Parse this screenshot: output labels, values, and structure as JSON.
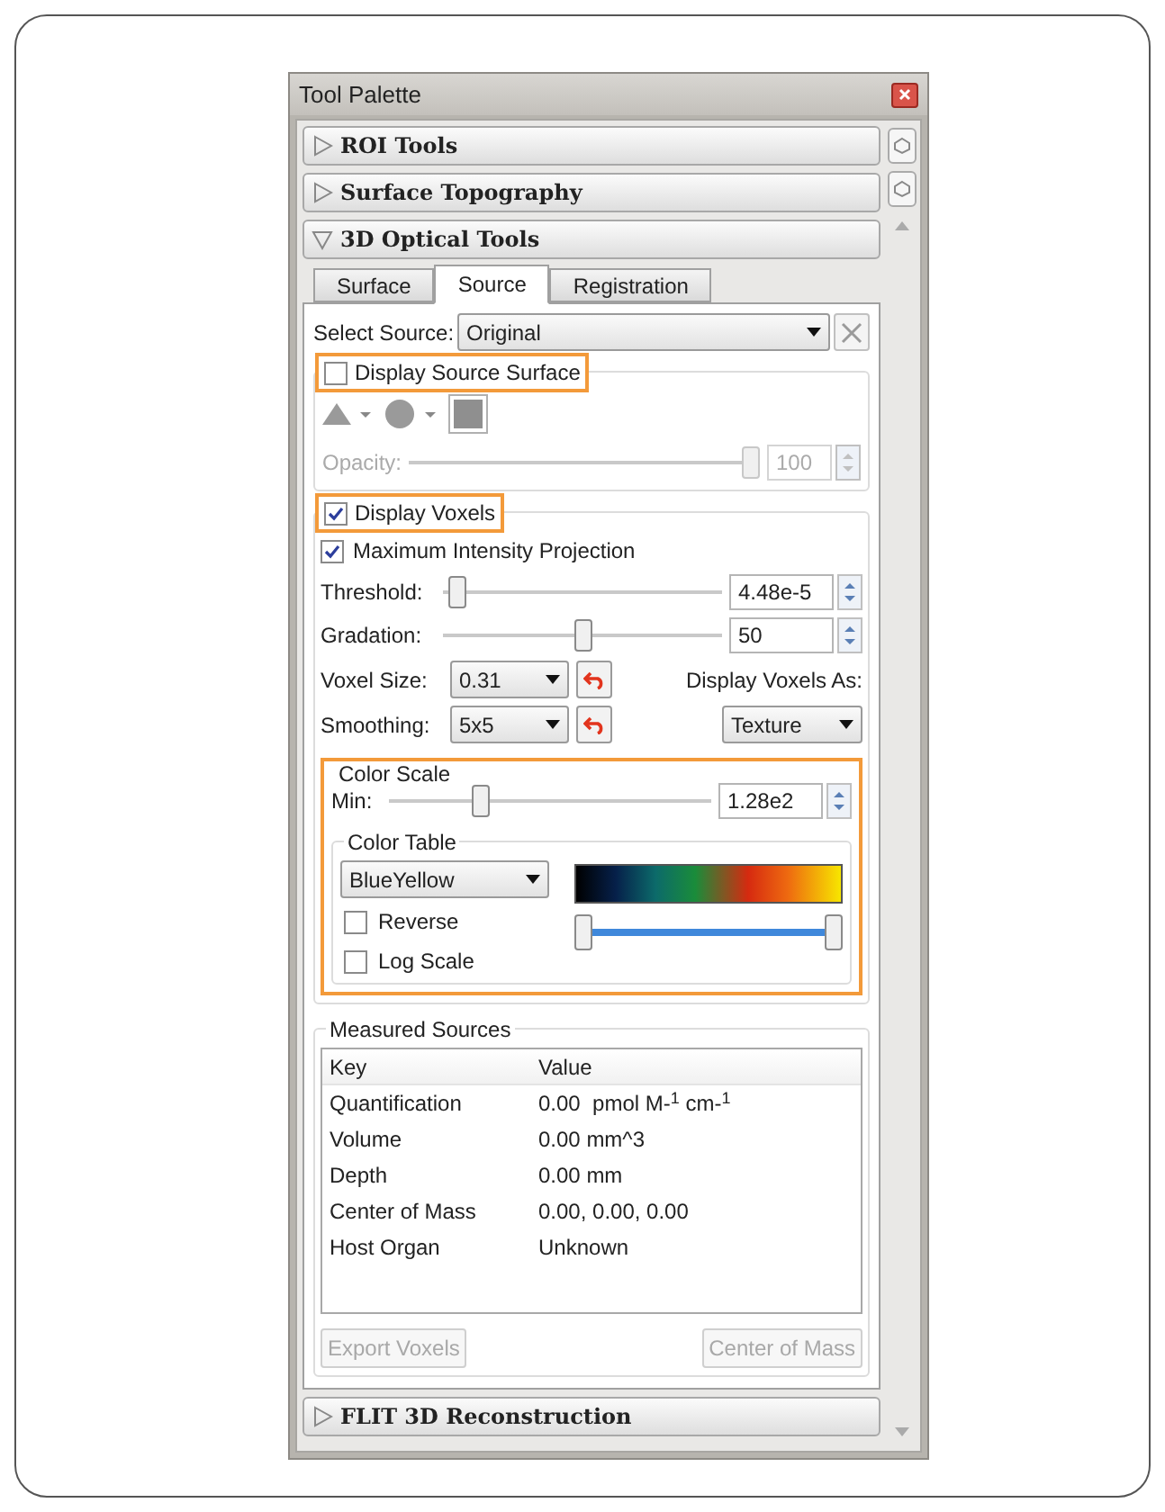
{
  "window": {
    "title": "Tool Palette"
  },
  "sections": [
    {
      "title": "ROI Tools",
      "expanded": false
    },
    {
      "title": "Surface Topography",
      "expanded": false
    },
    {
      "title": "3D Optical Tools",
      "expanded": true
    },
    {
      "title": "FLIT 3D Reconstruction",
      "expanded": false
    }
  ],
  "tabs": [
    {
      "label": "Surface",
      "selected": false
    },
    {
      "label": "Source",
      "selected": true
    },
    {
      "label": "Registration",
      "selected": false
    }
  ],
  "select_source": {
    "label": "Select Source:",
    "value": "Original"
  },
  "source_surface": {
    "label": "Display Source Surface",
    "checked": false,
    "highlighted": true,
    "disabled": true,
    "opacity_label": "Opacity:",
    "level": 1,
    "opacity_value": "100"
  },
  "voxels": {
    "label": "Display Voxels",
    "checked": true,
    "highlighted": true,
    "mip": {
      "label": "Maximum Intensity Projection",
      "checked": true
    },
    "sliders": [
      {
        "label": "Threshold:",
        "level": 0.02,
        "value": "4.48e-5"
      },
      {
        "label": "Gradation:",
        "level": 0.5,
        "value": "50"
      }
    ],
    "voxel_size": {
      "label": "Voxel Size:",
      "value": "0.31"
    },
    "smoothing": {
      "label": "Smoothing:",
      "value": "5x5"
    },
    "display_as": {
      "label": "Display Voxels As:",
      "value": "Texture"
    }
  },
  "color_scale": {
    "title": "Color Scale",
    "highlighted": true,
    "min": {
      "label": "Min:",
      "level": 0.27,
      "value": "1.28e2"
    },
    "color_table": {
      "title": "Color Table",
      "value": "BlueYellow",
      "options": [
        {
          "label": "Reverse",
          "checked": false
        },
        {
          "label": "Log Scale",
          "checked": false
        }
      ],
      "range_thumbs": [
        {
          "level": 0
        },
        {
          "level": 1
        }
      ]
    }
  },
  "measured": {
    "title": "Measured Sources",
    "columns": [
      "Key",
      "Value"
    ],
    "rows": [
      [
        "Quantification",
        "0.00  pmol M-$^{1}$ cm-$^{1}$"
      ],
      [
        "Volume",
        "0.00 mm^3"
      ],
      [
        "Depth",
        "0.00 mm"
      ],
      [
        "Center of Mass",
        "0.00, 0.00, 0.00"
      ],
      [
        "Host Organ",
        "Unknown"
      ]
    ],
    "buttons": [
      {
        "label": "Export Voxels",
        "disabled": true
      },
      {
        "label": "Center of Mass",
        "disabled": true
      }
    ]
  }
}
